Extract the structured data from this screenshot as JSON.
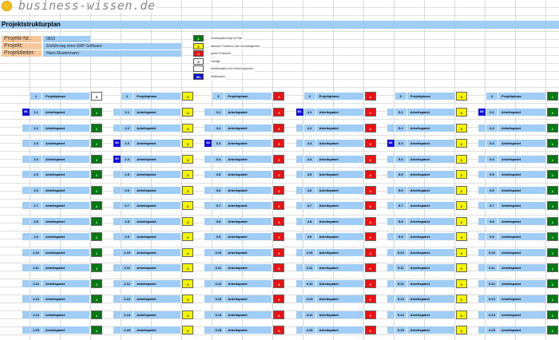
{
  "logo": {
    "text": "business-wissen.de"
  },
  "title": "Projektstrukturplan",
  "info": [
    {
      "label": "Projekt-Nr.:",
      "value": "0815"
    },
    {
      "label": "Projekt:",
      "value": "Einführung einer ERP-Software"
    },
    {
      "label": "Projektleiter:",
      "value": "Hans Mustermann"
    }
  ],
  "legend": [
    {
      "code": "1",
      "color": "#007a10",
      "text_color": "#ffffff",
      "text": "Arbeitspaket liegt im Plan"
    },
    {
      "code": "2",
      "color": "#f5f500",
      "text_color": "#000000",
      "text": "kleinere Probleme oder Schwierigkeiten"
    },
    {
      "code": "3",
      "color": "#ee1010",
      "text_color": "#ffffff",
      "text": "große Probleme"
    },
    {
      "code": "X",
      "color": "#ffffff",
      "text_color": "#000000",
      "text": "erledigt"
    },
    {
      "code": "",
      "color": "#ffffff",
      "text_color": "#000000",
      "text": "Arbeitspaket noch nicht begonnen"
    },
    {
      "code": "M1",
      "color": "#1010e0",
      "text_color": "#ffffff",
      "text": "Meilenstein"
    }
  ],
  "colors": {
    "1": "#007a10",
    "2": "#f5f500",
    "3": "#ee1010",
    "X": "#ffffff"
  },
  "phase_label": "Projektphase",
  "package_label": "Arbeitspaket",
  "phases": [
    {
      "number": "1",
      "status": "X",
      "package_status": "1",
      "milestones": {
        "1": "M1"
      }
    },
    {
      "number": "2",
      "status": "2",
      "package_status": "2",
      "milestones": {
        "3": "M1",
        "4": "M1"
      }
    },
    {
      "number": "3",
      "status": "3",
      "package_status": "3",
      "milestones": {
        "3": "M1"
      }
    },
    {
      "number": "4",
      "status": "3",
      "package_status": "3",
      "milestones": {
        "1": "M1"
      }
    },
    {
      "number": "5",
      "status": "2",
      "package_status": "2",
      "milestones": {
        "3": "M1"
      }
    },
    {
      "number": "6",
      "status": "1",
      "package_status": "1",
      "milestones": {
        "1": "M1"
      }
    }
  ],
  "packages_per_phase": 15
}
